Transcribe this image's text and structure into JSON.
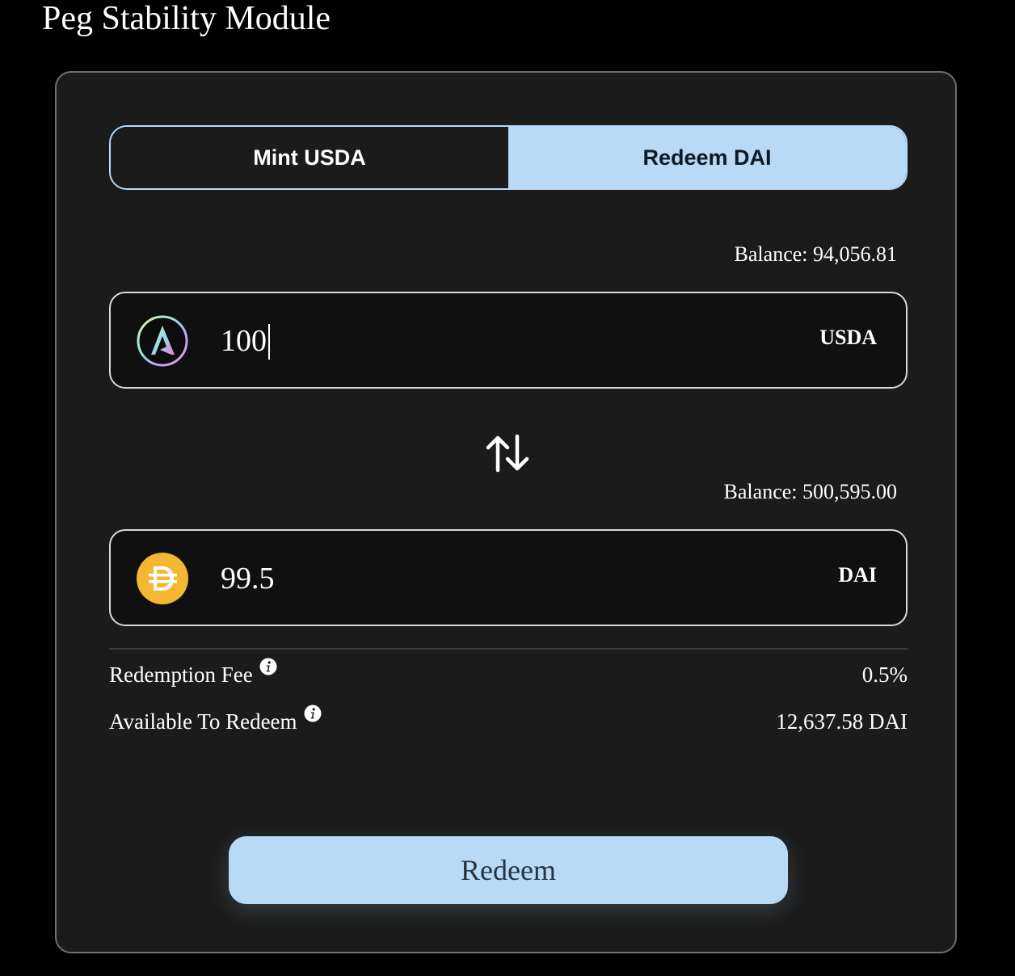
{
  "page": {
    "title": "Peg Stability Module"
  },
  "tabs": [
    {
      "label": "Mint USDA",
      "active": false
    },
    {
      "label": "Redeem DAI",
      "active": true
    }
  ],
  "from": {
    "balance_text": "Balance: 94,056.81",
    "amount": "100",
    "symbol": "USDA",
    "icon": "usda-logo-icon"
  },
  "swap": {
    "icon": "swap-arrows-icon"
  },
  "to": {
    "balance_text": "Balance: 500,595.00",
    "amount": "99.5",
    "symbol": "DAI",
    "icon": "dai-logo-icon"
  },
  "details": {
    "fee_label": "Redemption Fee",
    "fee_value": "0.5%",
    "available_label": "Available To Redeem",
    "available_value": "12,637.58 DAI"
  },
  "action": {
    "button_label": "Redeem"
  },
  "colors": {
    "accent": "#b8daf7",
    "card_bg": "#1b1b1b",
    "input_bg": "#101010",
    "page_bg": "#000000",
    "dai_gold": "#f4b731"
  }
}
